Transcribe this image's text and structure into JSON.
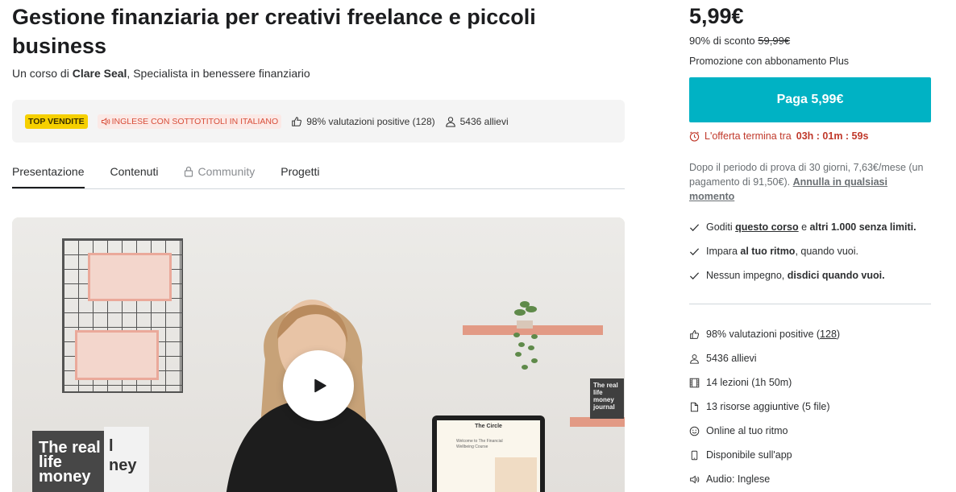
{
  "course": {
    "title": "Gestione finanziaria per creativi freelance e piccoli business",
    "byline_prefix": "Un corso di",
    "author": "Clare Seal",
    "author_suffix": ", Specialista in benessere finanziario"
  },
  "meta": {
    "badge_top": "TOP VENDITE",
    "badge_lang": "INGLESE CON SOTTOTITOLI IN ITALIANO",
    "rating": "98% valutazioni positive (128)",
    "students": "5436 allievi"
  },
  "tabs": [
    {
      "label": "Presentazione",
      "active": true
    },
    {
      "label": "Contenuti"
    },
    {
      "label": "Community",
      "locked": true
    },
    {
      "label": "Progetti"
    }
  ],
  "video": {
    "book_left_text": "The real life money",
    "book_left2_text": "l ney",
    "book_shelf_text": "The real life money journal",
    "tablet_title": "The Circle",
    "tablet_line1": "Welcome to The Financial",
    "tablet_line2": "Wellbeing Course"
  },
  "purchase": {
    "price": "5,99€",
    "discount": "90% di sconto",
    "original_price": "59,99€",
    "promo": "Promozione con abbonamento Plus",
    "pay_button": "Paga 5,99€",
    "timer_prefix": "L'offerta termina tra",
    "timer_value": "03h : 01m : 59s",
    "trial_text": "Dopo il periodo di prova di 30 giorni, 7,63€/mese (un pagamento di 91,50€).",
    "trial_link": "Annulla in qualsiasi momento"
  },
  "perks": [
    {
      "pre": "Goditi ",
      "link": "questo corso",
      "mid": " e ",
      "bold": "altri 1.000 senza limiti."
    },
    {
      "pre": "Impara ",
      "bold": "al tuo ritmo",
      "post": ", quando vuoi."
    },
    {
      "pre": "Nessun impegno, ",
      "bold": "disdici quando vuoi."
    }
  ],
  "features": [
    {
      "icon": "thumbs-up-icon",
      "text": "98% valutazioni positive (",
      "link": "128",
      "post": ")"
    },
    {
      "icon": "user-icon",
      "text": "5436 allievi"
    },
    {
      "icon": "film-icon",
      "text": "14 lezioni (1h 50m)"
    },
    {
      "icon": "file-icon",
      "text": "13 risorse aggiuntive (5 file)"
    },
    {
      "icon": "smile-icon",
      "text": "Online al tuo ritmo"
    },
    {
      "icon": "mobile-icon",
      "text": "Disponibile sull'app"
    },
    {
      "icon": "speaker-icon",
      "text": "Audio: Inglese"
    }
  ],
  "colors": {
    "accent": "#00b2c4",
    "badge_yellow": "#f6d000",
    "timer_red": "#c0392b"
  }
}
